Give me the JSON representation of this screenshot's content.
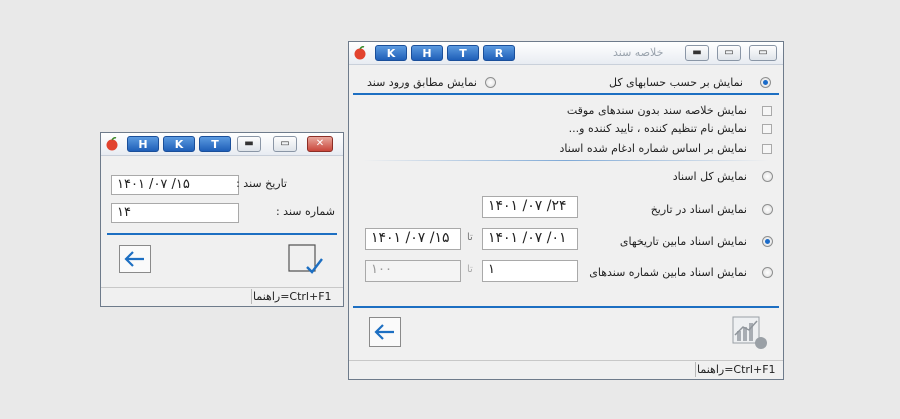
{
  "small_window": {
    "title_buttons": [
      "H",
      "K",
      "T"
    ],
    "date_label": "تاریخ سند :",
    "date_value": "۱۴۰۱  /۰۷  /۱۵",
    "number_label": "شماره سند :",
    "number_value": "۱۴",
    "status": "راهنما=Ctrl+F1"
  },
  "main_window": {
    "title": "خلاصه سند",
    "title_buttons": [
      "K",
      "H",
      "T",
      "R"
    ],
    "radio_by_accounts": "نمایش بر حسب حسابهای کل",
    "radio_by_entry": "نمایش مطابق ورود سند",
    "check_summary": "نمایش خلاصه سند بدون سندهای موقت",
    "check_names": "نمایش نام تنظیم کننده ، تایید کننده و...",
    "check_merged": "نمایش بر اساس شماره ادغام شده اسناد",
    "radio_all": "نمایش کل اسناد",
    "radio_in_date": "نمایش اسناد در تاریخ",
    "radio_between_dates": "نمایش اسناد مابین تاریخهای",
    "radio_between_numbers": "نمایش اسناد مابین شماره سندهای",
    "in_date_value": "۱۴۰۱ /۰۷ /۲۴",
    "from_date_value": "۱۴۰۱ /۰۷ /۰۱",
    "to_date_value": "۱۴۰۱ /۰۷ /۱۵",
    "from_number_value": "۱",
    "to_number_value": "۱۰۰",
    "to_label": "تا",
    "status": "راهنما=Ctrl+F1"
  },
  "colors": {
    "accent": "#1d6fc2",
    "title_button": "#1f5fb8"
  }
}
